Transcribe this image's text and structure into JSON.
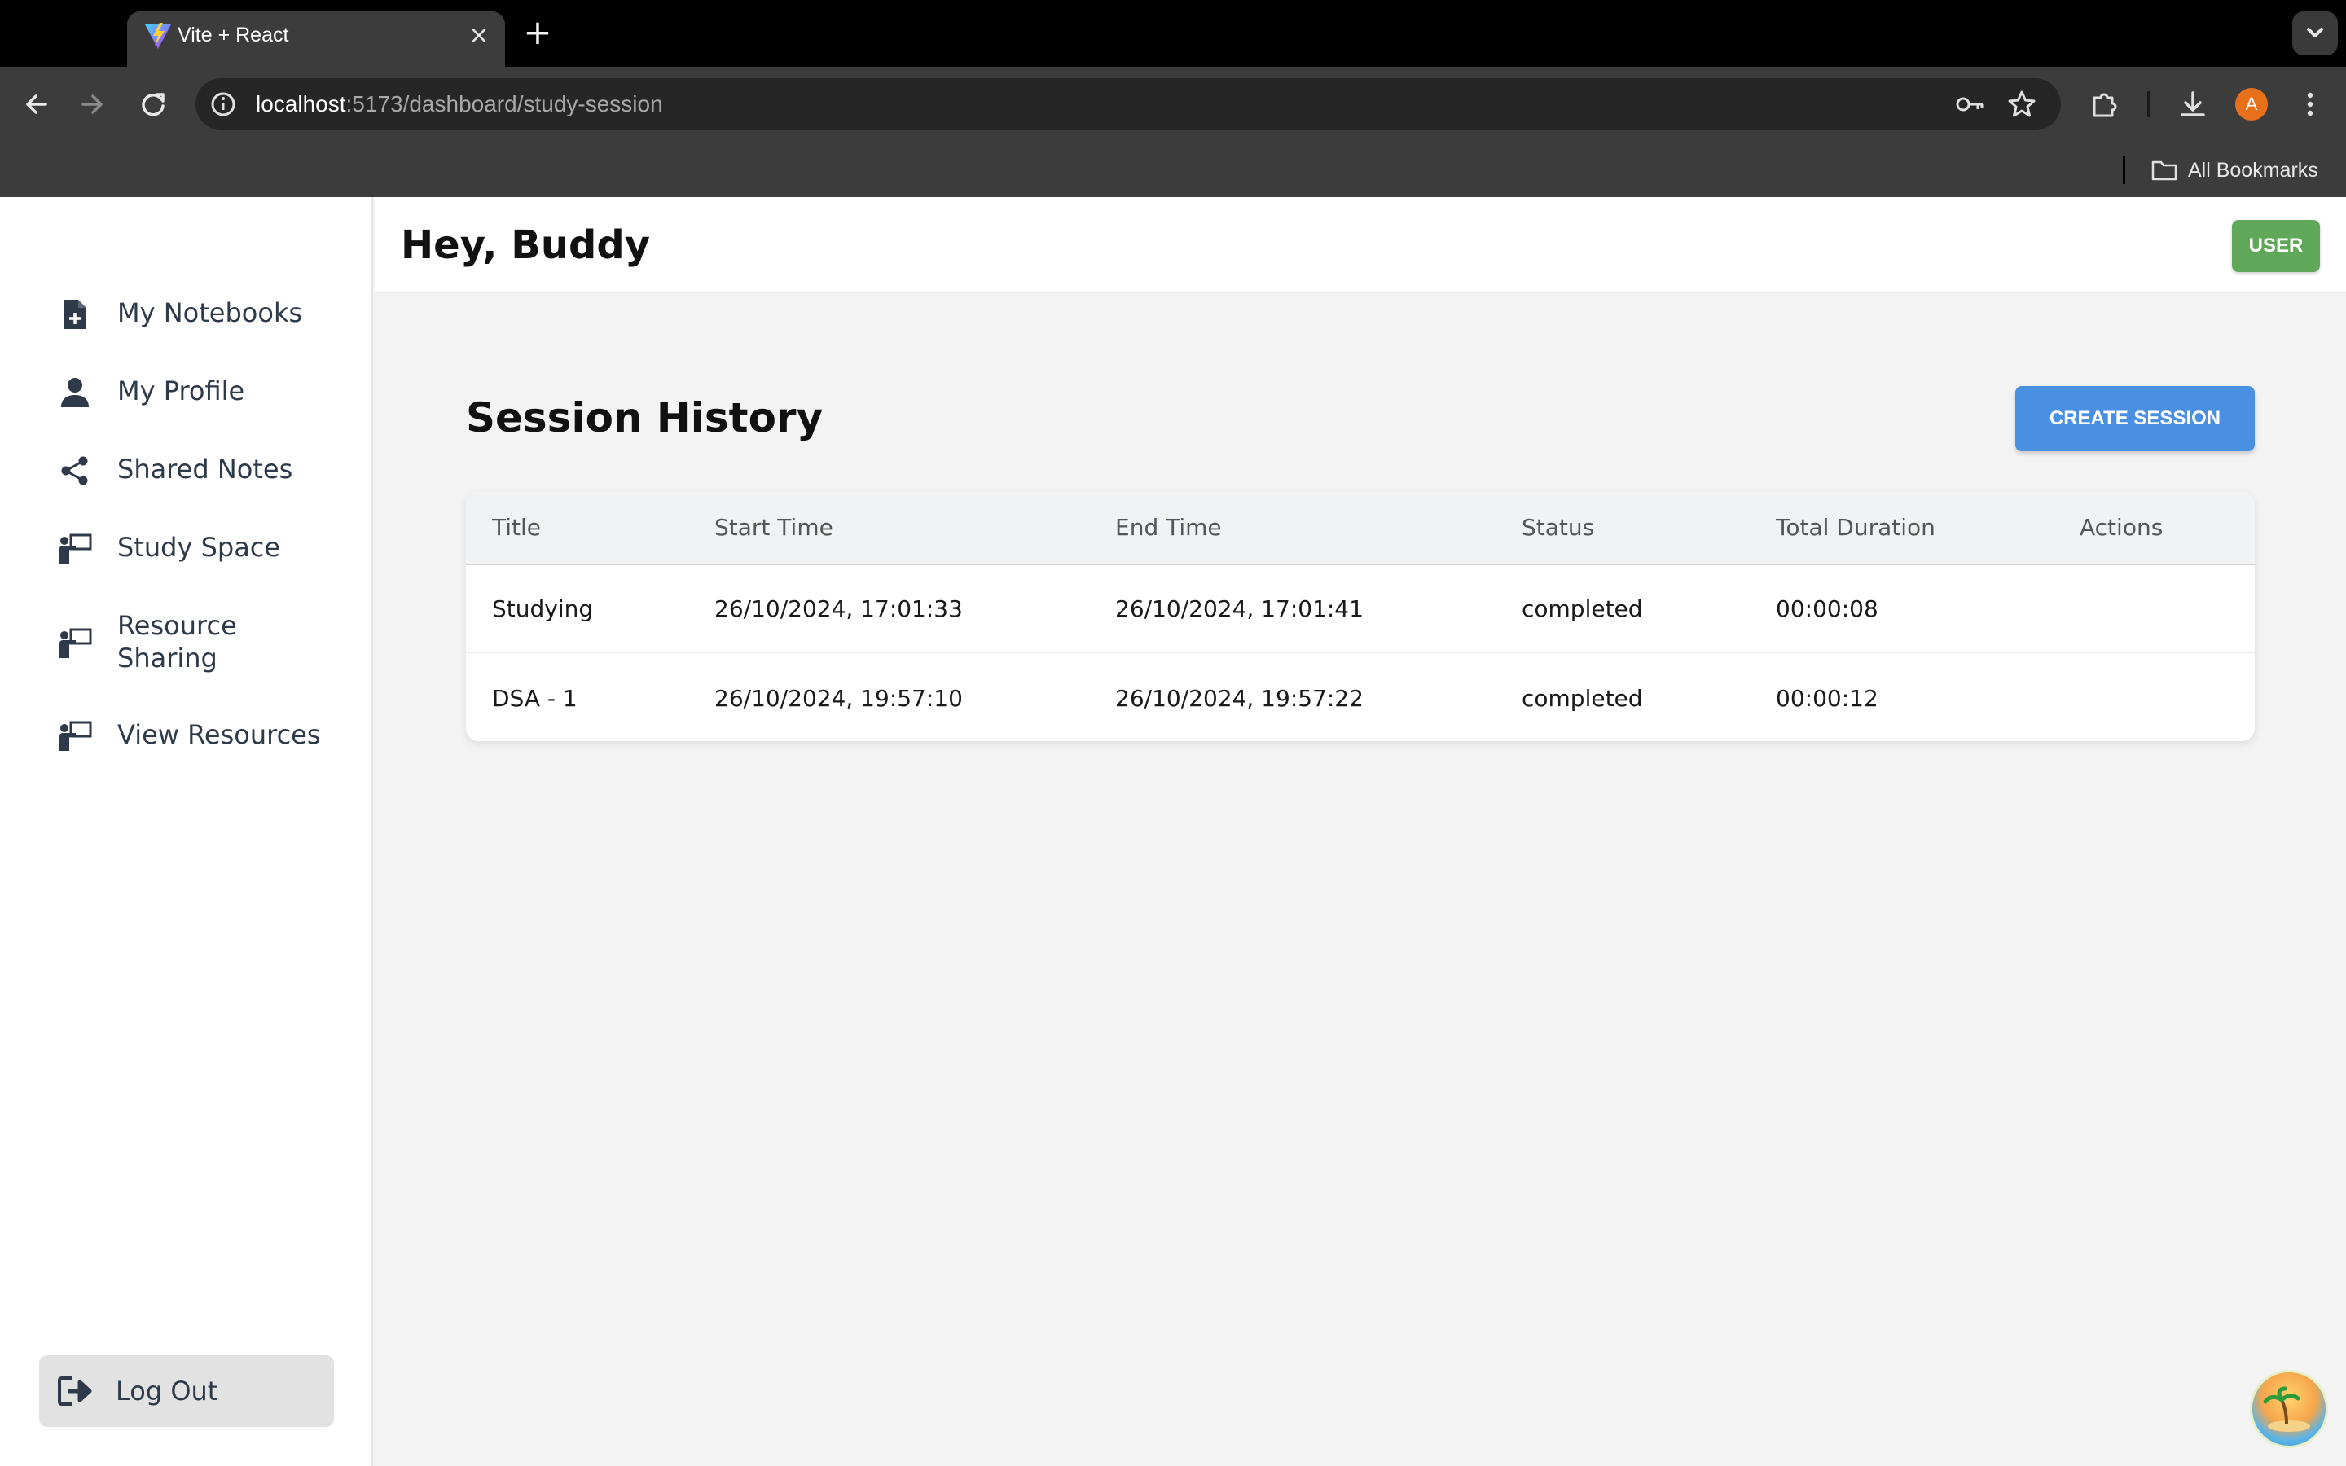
{
  "browser": {
    "tab_title": "Vite + React",
    "url_host": "localhost",
    "url_path": ":5173/dashboard/study-session",
    "profile_initial": "A",
    "bookmarks_label": "All Bookmarks"
  },
  "sidebar": {
    "items": [
      {
        "label": "My Notebooks",
        "icon": "notebook-add-icon"
      },
      {
        "label": "My Profile",
        "icon": "person-icon"
      },
      {
        "label": "Shared Notes",
        "icon": "share-icon"
      },
      {
        "label": "Study Space",
        "icon": "teacher-board-icon"
      },
      {
        "label": "Resource Sharing",
        "icon": "teacher-board-icon"
      },
      {
        "label": "View Resources",
        "icon": "teacher-board-icon"
      }
    ],
    "logout_label": "Log Out"
  },
  "header": {
    "greeting": "Hey, Buddy",
    "user_button": "USER"
  },
  "main": {
    "title": "Session History",
    "create_button": "CREATE SESSION",
    "table": {
      "columns": [
        "Title",
        "Start Time",
        "End Time",
        "Status",
        "Total Duration",
        "Actions"
      ],
      "rows": [
        [
          "Studying",
          "26/10/2024, 17:01:33",
          "26/10/2024, 17:01:41",
          "completed",
          "00:00:08",
          ""
        ],
        [
          "DSA - 1",
          "26/10/2024, 19:57:10",
          "26/10/2024, 19:57:22",
          "completed",
          "00:00:12",
          ""
        ]
      ]
    }
  },
  "colors": {
    "primary_button": "#4a90e2",
    "user_badge": "#5fa85a",
    "sidebar_text": "#2e3a4a"
  }
}
